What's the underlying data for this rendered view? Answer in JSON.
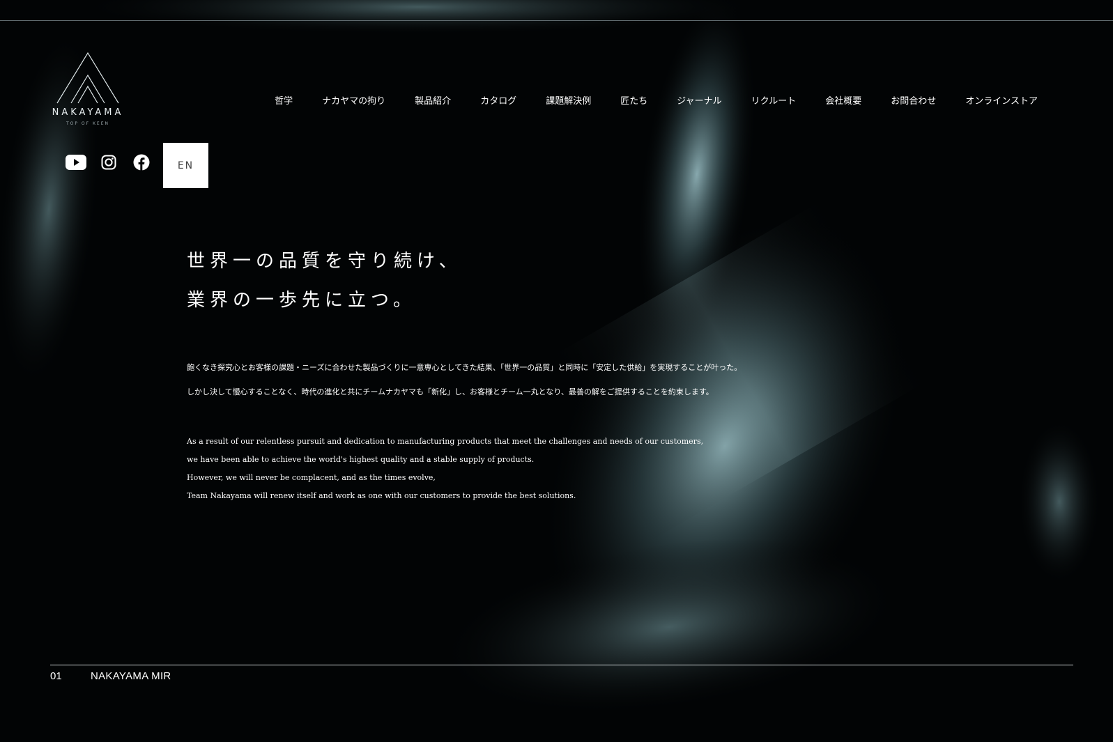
{
  "brand": {
    "name": "NAKAYAMA",
    "tagline": "TOP OF KEEN"
  },
  "nav": {
    "items": [
      "哲学",
      "ナカヤマの拘り",
      "製品紹介",
      "カタログ",
      "課題解決例",
      "匠たち",
      "ジャーナル",
      "リクルート",
      "会社概要",
      "お問合わせ",
      "オンラインストア"
    ]
  },
  "social": {
    "icons": [
      "youtube-icon",
      "instagram-icon",
      "facebook-icon"
    ],
    "lang_label": "EN"
  },
  "hero": {
    "line1": "世界一の品質を守り続け、",
    "line2": "業界の一歩先に立つ。"
  },
  "copy": {
    "jp": [
      "飽くなき探究心とお客様の課題・ニーズに合わせた製品づくりに一意専心としてきた結果、「世界一の品質」と同時に「安定した供給」を実現することが叶った。",
      "しかし決して慢心することなく、時代の進化と共にチームナカヤマも「新化」し、お客様とチーム一丸となり、最善の解をご提供することを約束します。"
    ],
    "en": [
      "As a result of our relentless pursuit and dedication to manufacturing products that meet the challenges and needs of our customers,",
      "we have been able to achieve the world's highest quality and a stable supply of products.",
      "However, we will never be complacent, and as the times evolve,",
      "Team Nakayama will renew itself and work as one with our customers to provide the best solutions."
    ]
  },
  "footer": {
    "slide_number": "01",
    "slide_title": "NAKAYAMA MIR"
  },
  "colors": {
    "background": "#020405",
    "accent_glow": "#8fb6bd",
    "text": "#ffffff"
  }
}
